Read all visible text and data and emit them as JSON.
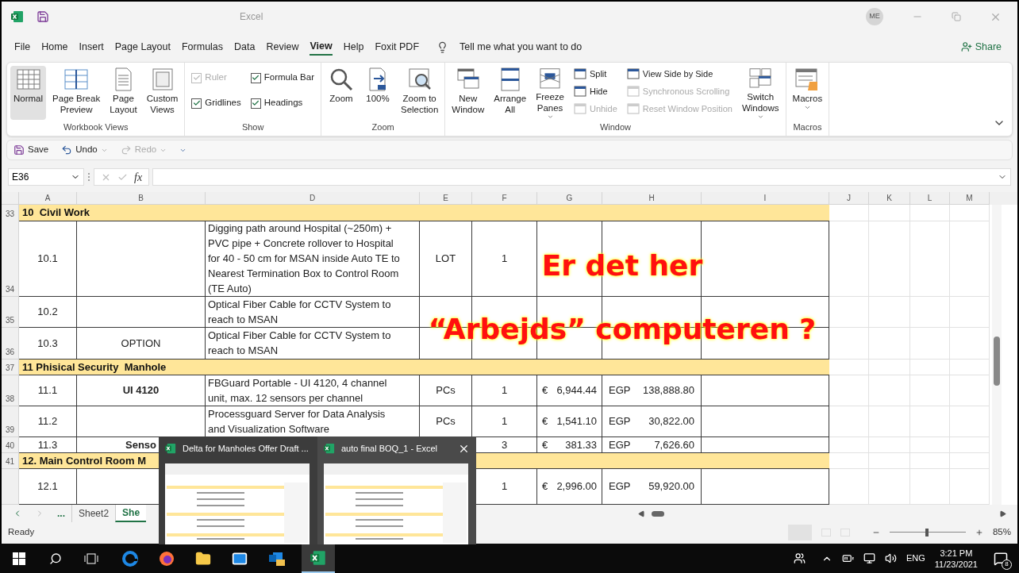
{
  "window": {
    "title": "Excel",
    "account_initials": "ME"
  },
  "menu": [
    {
      "label": "File",
      "selected": false
    },
    {
      "label": "Home",
      "selected": false
    },
    {
      "label": "Insert",
      "selected": false
    },
    {
      "label": "Page Layout",
      "selected": false
    },
    {
      "label": "Formulas",
      "selected": false
    },
    {
      "label": "Data",
      "selected": false
    },
    {
      "label": "Review",
      "selected": false
    },
    {
      "label": "View",
      "selected": true
    },
    {
      "label": "Help",
      "selected": false
    },
    {
      "label": "Foxit PDF",
      "selected": false
    }
  ],
  "tell_me": "Tell me what you want to do",
  "share": "Share",
  "ribbon_groups": [
    {
      "label": "Workbook Views",
      "columns": [
        {
          "kind": "large",
          "label": "Normal",
          "selected": true
        },
        {
          "kind": "large",
          "label": "Page Break\nPreview",
          "selected": false
        },
        {
          "kind": "large",
          "label": "Page\nLayout",
          "selected": false
        },
        {
          "kind": "large",
          "label": "Custom\nViews",
          "selected": false
        }
      ]
    },
    {
      "label": "Show",
      "columns": [
        {
          "kind": "stack",
          "items": [
            {
              "kind": "check",
              "label": "Ruler",
              "checked": true,
              "disabled": true
            },
            {
              "kind": "check",
              "label": "Gridlines",
              "checked": true,
              "disabled": false
            }
          ]
        },
        {
          "kind": "stack",
          "items": [
            {
              "kind": "check",
              "label": "Formula Bar",
              "checked": true,
              "disabled": false
            },
            {
              "kind": "check",
              "label": "Headings",
              "checked": true,
              "disabled": false
            }
          ]
        }
      ]
    },
    {
      "label": "Zoom",
      "columns": [
        {
          "kind": "large",
          "label": "Zoom"
        },
        {
          "kind": "large",
          "label": "100%"
        },
        {
          "kind": "large",
          "label": "Zoom to\nSelection"
        }
      ]
    },
    {
      "label": "Window",
      "columns": [
        {
          "kind": "large",
          "label": "New\nWindow"
        },
        {
          "kind": "large",
          "label": "Arrange\nAll"
        },
        {
          "kind": "large",
          "label": "Freeze\nPanes",
          "dropdown": true
        },
        {
          "kind": "stack",
          "items": [
            {
              "kind": "small",
              "label": "Split",
              "disabled": false
            },
            {
              "kind": "small",
              "label": "Hide",
              "disabled": false
            },
            {
              "kind": "small",
              "label": "Unhide",
              "disabled": true
            }
          ]
        },
        {
          "kind": "stack",
          "items": [
            {
              "kind": "small",
              "label": "View Side by Side",
              "disabled": false
            },
            {
              "kind": "small",
              "label": "Synchronous Scrolling",
              "disabled": true
            },
            {
              "kind": "small",
              "label": "Reset Window Position",
              "disabled": true
            }
          ]
        },
        {
          "kind": "large",
          "label": "Switch\nWindows",
          "dropdown": true
        }
      ]
    },
    {
      "label": "Macros",
      "columns": [
        {
          "kind": "large",
          "label": "Macros",
          "dropdown": true
        }
      ]
    }
  ],
  "quick_access": [
    {
      "label": "Save",
      "disabled": false,
      "dropdown": false
    },
    {
      "label": "Undo",
      "disabled": false,
      "dropdown": true
    },
    {
      "label": "Redo",
      "disabled": true,
      "dropdown": true
    }
  ],
  "formula_bar": {
    "name_box": "E36",
    "function_label": "fx"
  },
  "columns": [
    "A",
    "B",
    "D",
    "E",
    "F",
    "G",
    "H",
    "I",
    "J",
    "K",
    "L",
    "M"
  ],
  "rows": [
    {
      "number": "33",
      "kind": "section",
      "title": "10  Civil Work"
    },
    {
      "number": "34",
      "kind": "item",
      "a": "10.1",
      "d": "Digging path around Hospital (~250m) + PVC pipe + Concrete rollover to Hospital for 40 - 50 cm for MSAN inside Auto TE to Nearest Termination Box to Control Room (TE Auto)",
      "e": "LOT",
      "f": "1"
    },
    {
      "number": "35",
      "kind": "item",
      "a": "10.2",
      "d": "Optical Fiber Cable for CCTV System to reach to MSAN"
    },
    {
      "number": "36",
      "kind": "item",
      "a": "10.3",
      "b": "OPTION",
      "b_bold": false,
      "d": "Optical Fiber Cable for CCTV System to reach to MSAN"
    },
    {
      "number": "37",
      "kind": "section",
      "title": "11 Phisical Security  Manhole"
    },
    {
      "number": "38",
      "kind": "item",
      "a": "11.1",
      "b": "UI 4120",
      "b_bold": true,
      "d": "FBGuard Portable - UI 4120, 4 channel unit, max. 12 sensors per channel",
      "e": "PCs",
      "f": "1",
      "g_currency": "€",
      "g": "6,944.44",
      "h_currency": "EGP",
      "h": "138,888.80"
    },
    {
      "number": "39",
      "kind": "item",
      "a": "11.2",
      "d": "Processguard Server for Data Analysis and Visualization Software",
      "e": "PCs",
      "f": "1",
      "g_currency": "€",
      "g": "1,541.10",
      "h_currency": "EGP",
      "h": "30,822.00"
    },
    {
      "number": "40",
      "kind": "item",
      "a": "11.3",
      "b": "Senso",
      "b_bold": true,
      "f": "3",
      "g_currency": "€",
      "g": "381.33",
      "h_currency": "EGP",
      "h": "7,626.60"
    },
    {
      "number": "41",
      "kind": "section",
      "title": "12. Main Control Room M"
    },
    {
      "kind": "item",
      "a": "12.1",
      "f": "1",
      "g_currency": "€",
      "g": "2,996.00",
      "h_currency": "EGP",
      "h": "59,920.00"
    }
  ],
  "sheet_tabs": {
    "more": "...",
    "tabs": [
      {
        "label": "Sheet2",
        "selected": false
      },
      {
        "label": "She",
        "selected": true
      }
    ]
  },
  "status": {
    "text": "Ready",
    "zoom": {
      "level": 0.47,
      "reading": "85%"
    }
  },
  "window_previews": [
    {
      "title": "Delta for Manholes Offer Draft ...",
      "selected": false
    },
    {
      "title": "auto final BOQ_1 - Excel",
      "selected": true
    }
  ],
  "caption": {
    "lines": [
      "Er det her",
      "“Arbejds” computeren ?"
    ]
  },
  "taskbar": {
    "language": "ENG",
    "time": "3:21 PM",
    "date": "11/23/2021",
    "notification_count": "8"
  }
}
